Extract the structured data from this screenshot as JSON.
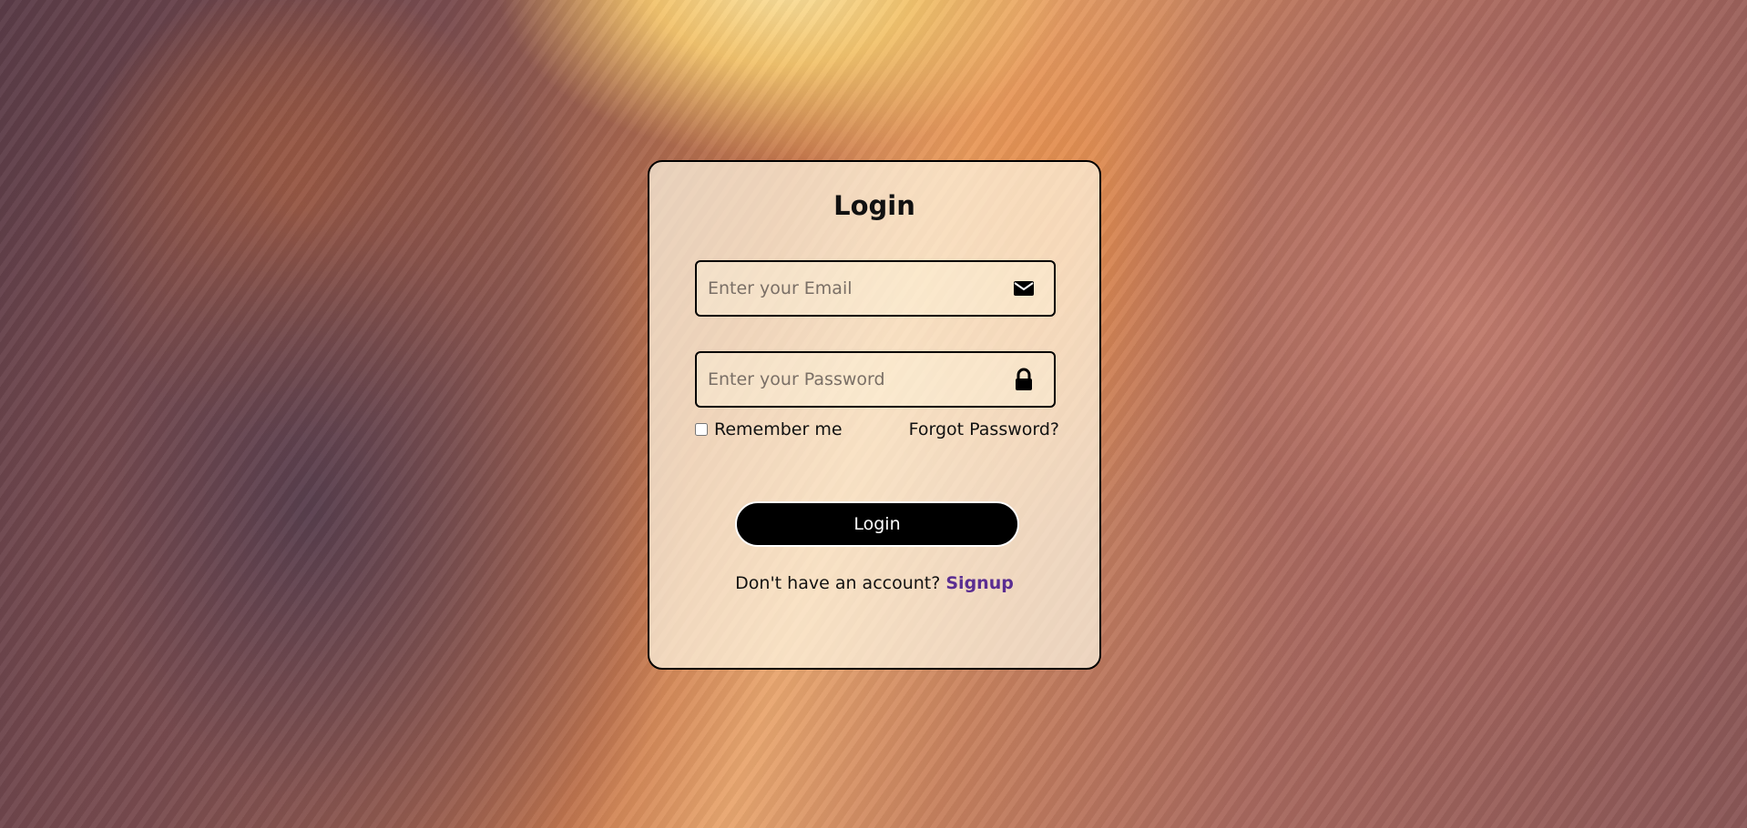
{
  "colors": {
    "card_border": "#000000",
    "button_bg": "#000000",
    "button_text": "#ffffff",
    "link": "#5a2d91"
  },
  "login_form": {
    "title": "Login",
    "email": {
      "placeholder": "Enter your Email",
      "value": "",
      "icon": "envelope-icon"
    },
    "password": {
      "placeholder": "Enter your Password",
      "value": "",
      "icon": "lock-icon"
    },
    "remember_label": "Remember me",
    "remember_checked": false,
    "forgot_label": "Forgot Password?",
    "submit_label": "Login",
    "signup_prompt": "Don't have an account?",
    "signup_link": "Signup"
  }
}
